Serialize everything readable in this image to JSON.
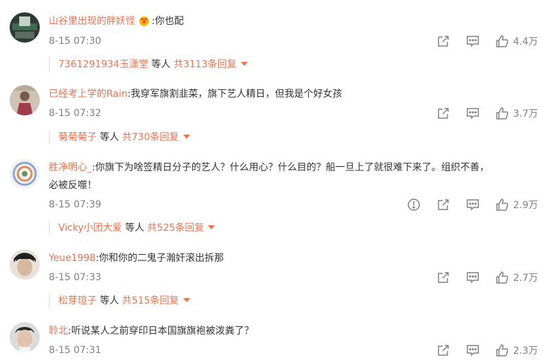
{
  "colors": {
    "accent": "#eb7350",
    "meta": "#808080",
    "text": "#333333"
  },
  "comments": [
    {
      "username": "山谷里出现的胖妖怪",
      "badge_icon": "crown-badge-icon",
      "separator": ":",
      "content": "你也配",
      "time": "8-15 07:30",
      "likes": "4.4万",
      "reply_user": "7361291934玉潇堂",
      "reply_mid": "等人",
      "reply_count": "共3113条回复"
    },
    {
      "username": "已经考上学的Rain",
      "separator": ":",
      "content": "我穿军旗割韭菜，旗下艺人精日，但我是个好女孩",
      "time": "8-15 07:32",
      "likes": "3.7万",
      "reply_user": "菊菊菊子",
      "reply_mid": "等人",
      "reply_count": "共730条回复"
    },
    {
      "username": "胜净明心_",
      "separator": ":",
      "content": "你旗下为啥签精日分子的艺人？什么用心？什么目的？船一旦上了就很难下来了。组织不善，",
      "content2": "必被反噬！",
      "time": "8-15 07:39",
      "likes": "2.9万",
      "reply_user": "Vicky小团大爱",
      "reply_mid": "等人",
      "reply_count": "共525条回复"
    },
    {
      "username": "Yeue1998",
      "separator": ":",
      "content": "你和你的二鬼子瀚奸滚出拆那",
      "time": "8-15 07:33",
      "likes": "2.7万",
      "reply_user": "松芽瑄子",
      "reply_mid": "等人",
      "reply_count": "共515条回复"
    },
    {
      "username": "聆北",
      "separator": ":",
      "content": "听说某人之前穿印日本国旗旗袍被泼粪了？",
      "time": "8-15 07:31",
      "likes": "2.3万"
    }
  ]
}
